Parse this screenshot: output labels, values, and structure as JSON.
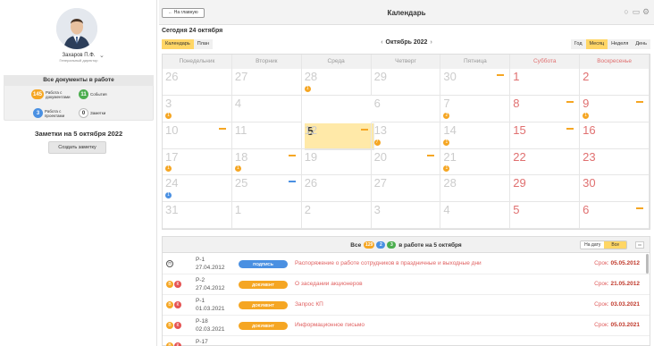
{
  "user": {
    "name": "Захаров П.Ф.",
    "role": "Генеральный директор"
  },
  "documents": {
    "title": "Все документы в работе",
    "stats": [
      {
        "count": "145",
        "label": "Работа с документами",
        "color": "#f5a623"
      },
      {
        "count": "11",
        "label": "События",
        "color": "#4cae4f"
      },
      {
        "count": "3",
        "label": "Работа с проектами",
        "color": "#4a90e2"
      },
      {
        "count": "0",
        "label": "Заметки",
        "color": "#ffffff"
      }
    ]
  },
  "notes": {
    "title": "Заметки на 5 октября 2022",
    "create_label": "Создать заметку"
  },
  "header": {
    "home_label": "← На главную",
    "title": "Календарь"
  },
  "today_label": "Сегодня 24 октября",
  "view_tabs": [
    {
      "label": "Календарь",
      "active": true
    },
    {
      "label": "План",
      "active": false
    }
  ],
  "month_nav": {
    "prev": "‹",
    "label": "Октябрь 2022",
    "next": "›"
  },
  "period_tabs": [
    {
      "label": "Год",
      "active": false
    },
    {
      "label": "Месяц",
      "active": true
    },
    {
      "label": "Неделя",
      "active": false
    },
    {
      "label": "День",
      "active": false
    }
  ],
  "weekdays": [
    "Понедельник",
    "Вторник",
    "Среда",
    "Четверг",
    "Пятница",
    "Суббота",
    "Воскресенье"
  ],
  "calendar_days": [
    {
      "d": "26",
      "cur": false
    },
    {
      "d": "27",
      "cur": false
    },
    {
      "d": "28",
      "cur": false,
      "dot": "1"
    },
    {
      "d": "29",
      "cur": false
    },
    {
      "d": "30",
      "cur": false,
      "bar": "orange"
    },
    {
      "d": "1",
      "cur": true
    },
    {
      "d": "2",
      "cur": true
    },
    {
      "d": "3",
      "cur": false,
      "dot": "1"
    },
    {
      "d": "4",
      "cur": false
    },
    {
      "d": "5",
      "cur": true,
      "today": true,
      "bar": "orange"
    },
    {
      "d": "6",
      "cur": false
    },
    {
      "d": "7",
      "cur": false,
      "dot": "2"
    },
    {
      "d": "8",
      "cur": true,
      "bar": "orange"
    },
    {
      "d": "9",
      "cur": true,
      "dot": "1",
      "bar": "orange"
    },
    {
      "d": "10",
      "cur": false,
      "bar": "orange"
    },
    {
      "d": "11",
      "cur": false
    },
    {
      "d": "12",
      "cur": false
    },
    {
      "d": "13",
      "cur": false,
      "dot": "7"
    },
    {
      "d": "14",
      "cur": false,
      "dot": "1"
    },
    {
      "d": "15",
      "cur": true,
      "bar": "orange"
    },
    {
      "d": "16",
      "cur": true
    },
    {
      "d": "17",
      "cur": false,
      "dot": "1"
    },
    {
      "d": "18",
      "cur": false,
      "dot": "1",
      "bar": "orange"
    },
    {
      "d": "19",
      "cur": false
    },
    {
      "d": "20",
      "cur": false,
      "bar": "orange"
    },
    {
      "d": "21",
      "cur": false,
      "dot": "1"
    },
    {
      "d": "22",
      "cur": true
    },
    {
      "d": "23",
      "cur": true
    },
    {
      "d": "24",
      "cur": false,
      "dot": "1",
      "dotcolor": "blue"
    },
    {
      "d": "25",
      "cur": false,
      "bar": "blue"
    },
    {
      "d": "26",
      "cur": false
    },
    {
      "d": "27",
      "cur": false
    },
    {
      "d": "28",
      "cur": false
    },
    {
      "d": "29",
      "cur": true
    },
    {
      "d": "30",
      "cur": true
    },
    {
      "d": "31",
      "cur": false
    },
    {
      "d": "1",
      "cur": false
    },
    {
      "d": "2",
      "cur": false
    },
    {
      "d": "3",
      "cur": false
    },
    {
      "d": "4",
      "cur": false
    },
    {
      "d": "5",
      "cur": true
    },
    {
      "d": "6",
      "cur": true,
      "bar": "orange"
    }
  ],
  "bottom": {
    "title_prefix": "Все",
    "pills": [
      {
        "v": "129",
        "c": "#f5a623"
      },
      {
        "v": "2",
        "c": "#4a90e2"
      },
      {
        "v": "3",
        "c": "#4cae4f"
      }
    ],
    "title_suffix": "в работе на 5 октября",
    "filter": [
      {
        "label": "На дату",
        "active": false
      },
      {
        "label": "Все",
        "active": true
      }
    ],
    "deadline_label": "Срок: ",
    "rows": [
      {
        "icons": [
          "c:П"
        ],
        "code": "Р-1",
        "date": "27.04.2012",
        "tag": "ПОДПИСЬ",
        "tagcolor": "#4a90e2",
        "subject": "Распоряжение о работе сотрудников в праздничные и выходные дни",
        "deadline": "05.05.2012"
      },
      {
        "icons": [
          "o:В",
          "r:К"
        ],
        "code": "Р-2",
        "date": "27.04.2012",
        "tag": "ДОКУМЕНТ",
        "tagcolor": "#f5a623",
        "subject": "О заседании акционеров",
        "deadline": "21.05.2012"
      },
      {
        "icons": [
          "o:В",
          "r:К"
        ],
        "code": "Р-1",
        "date": "01.03.2021",
        "tag": "ДОКУМЕНТ",
        "tagcolor": "#f5a623",
        "subject": "Запрос КП",
        "deadline": "03.03.2021"
      },
      {
        "icons": [
          "o:В",
          "r:К"
        ],
        "code": "Р-18",
        "date": "02.03.2021",
        "tag": "ДОКУМЕНТ",
        "tagcolor": "#f5a623",
        "subject": "Информационное письмо",
        "deadline": "05.03.2021"
      },
      {
        "icons": [
          "o:В",
          "r:К"
        ],
        "code": "Р-17",
        "date": "",
        "tag": "",
        "tagcolor": "#f5a623",
        "subject": "",
        "deadline": ""
      }
    ]
  }
}
